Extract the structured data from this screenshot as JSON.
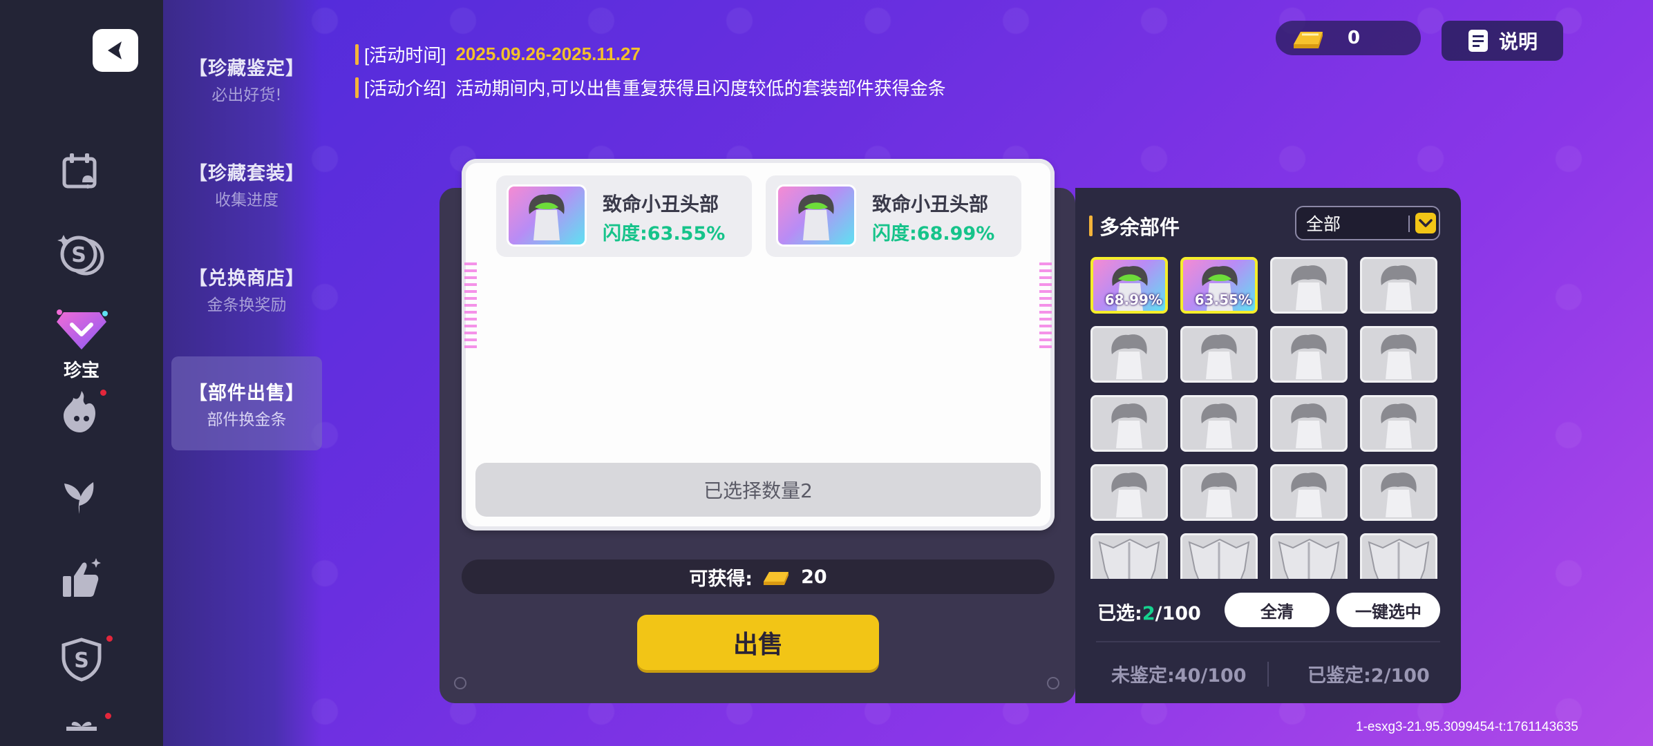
{
  "sidebar": {
    "active_label": "珍宝"
  },
  "submenu": [
    {
      "title": "【珍藏鉴定】",
      "desc": "必出好货!"
    },
    {
      "title": "【珍藏套装】",
      "desc": "收集进度"
    },
    {
      "title": "【兑换商店】",
      "desc": "金条换奖励"
    },
    {
      "title": "【部件出售】",
      "desc": "部件换金条"
    }
  ],
  "header": {
    "time_label": "[活动时间]",
    "time_value": "2025.09.26-2025.11.27",
    "intro_label": "[活动介绍]",
    "intro_text": "活动期间内,可以出售重复获得且闪度较低的套装部件获得金条",
    "gold_count": "0",
    "help_label": "说明"
  },
  "selected_items": [
    {
      "name": "致命小丑头部",
      "rate": "闪度:63.55%"
    },
    {
      "name": "致命小丑头部",
      "rate": "闪度:68.99%"
    }
  ],
  "selected_count_label": "已选择数量2",
  "obtain": {
    "label": "可获得:",
    "value": "20"
  },
  "sell_button": "出售",
  "inventory": {
    "title": "多余部件",
    "filter_value": "全部",
    "selected_pcts": [
      "68.99%",
      "63.55%"
    ],
    "chosen_prefix": "已选:",
    "chosen_count": "2",
    "chosen_total": "/100",
    "clear_button": "全清",
    "select_all_button": "一键选中",
    "unidentified": "未鉴定:40/100",
    "identified": "已鉴定:2/100"
  },
  "colors": {
    "accent_yellow": "#f2c516",
    "rate_green": "#16c38a",
    "date_gold": "#f3c12b"
  },
  "footer_id": "1-esxg3-21.95.3099454-t:1761143635"
}
